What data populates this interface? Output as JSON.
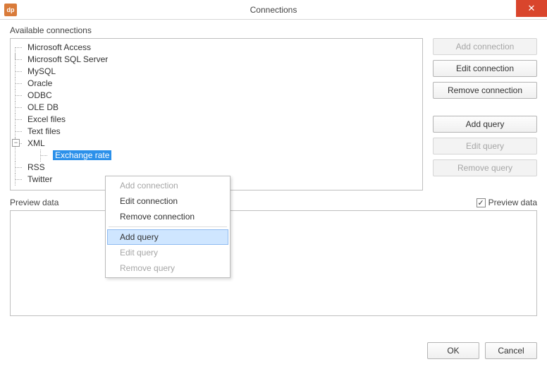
{
  "window": {
    "app_icon_text": "dp",
    "title": "Connections",
    "close_glyph": "✕"
  },
  "labels": {
    "available": "Available connections",
    "preview": "Preview data",
    "preview_checkbox": "Preview data"
  },
  "tree": {
    "items": [
      "Microsoft Access",
      "Microsoft SQL Server",
      "MySQL",
      "Oracle",
      "ODBC",
      "OLE DB",
      "Excel files",
      "Text files"
    ],
    "xml_label": "XML",
    "xml_child": "Exchange rate",
    "tail": [
      "RSS",
      "Twitter"
    ],
    "expander_glyph": "−"
  },
  "buttons": {
    "add_connection": "Add connection",
    "edit_connection": "Edit connection",
    "remove_connection": "Remove connection",
    "add_query": "Add query",
    "edit_query": "Edit query",
    "remove_query": "Remove query",
    "ok": "OK",
    "cancel": "Cancel"
  },
  "context_menu": {
    "add_connection": "Add connection",
    "edit_connection": "Edit connection",
    "remove_connection": "Remove connection",
    "add_query": "Add query",
    "edit_query": "Edit query",
    "remove_query": "Remove query"
  },
  "checkbox": {
    "checked_glyph": "✓"
  }
}
